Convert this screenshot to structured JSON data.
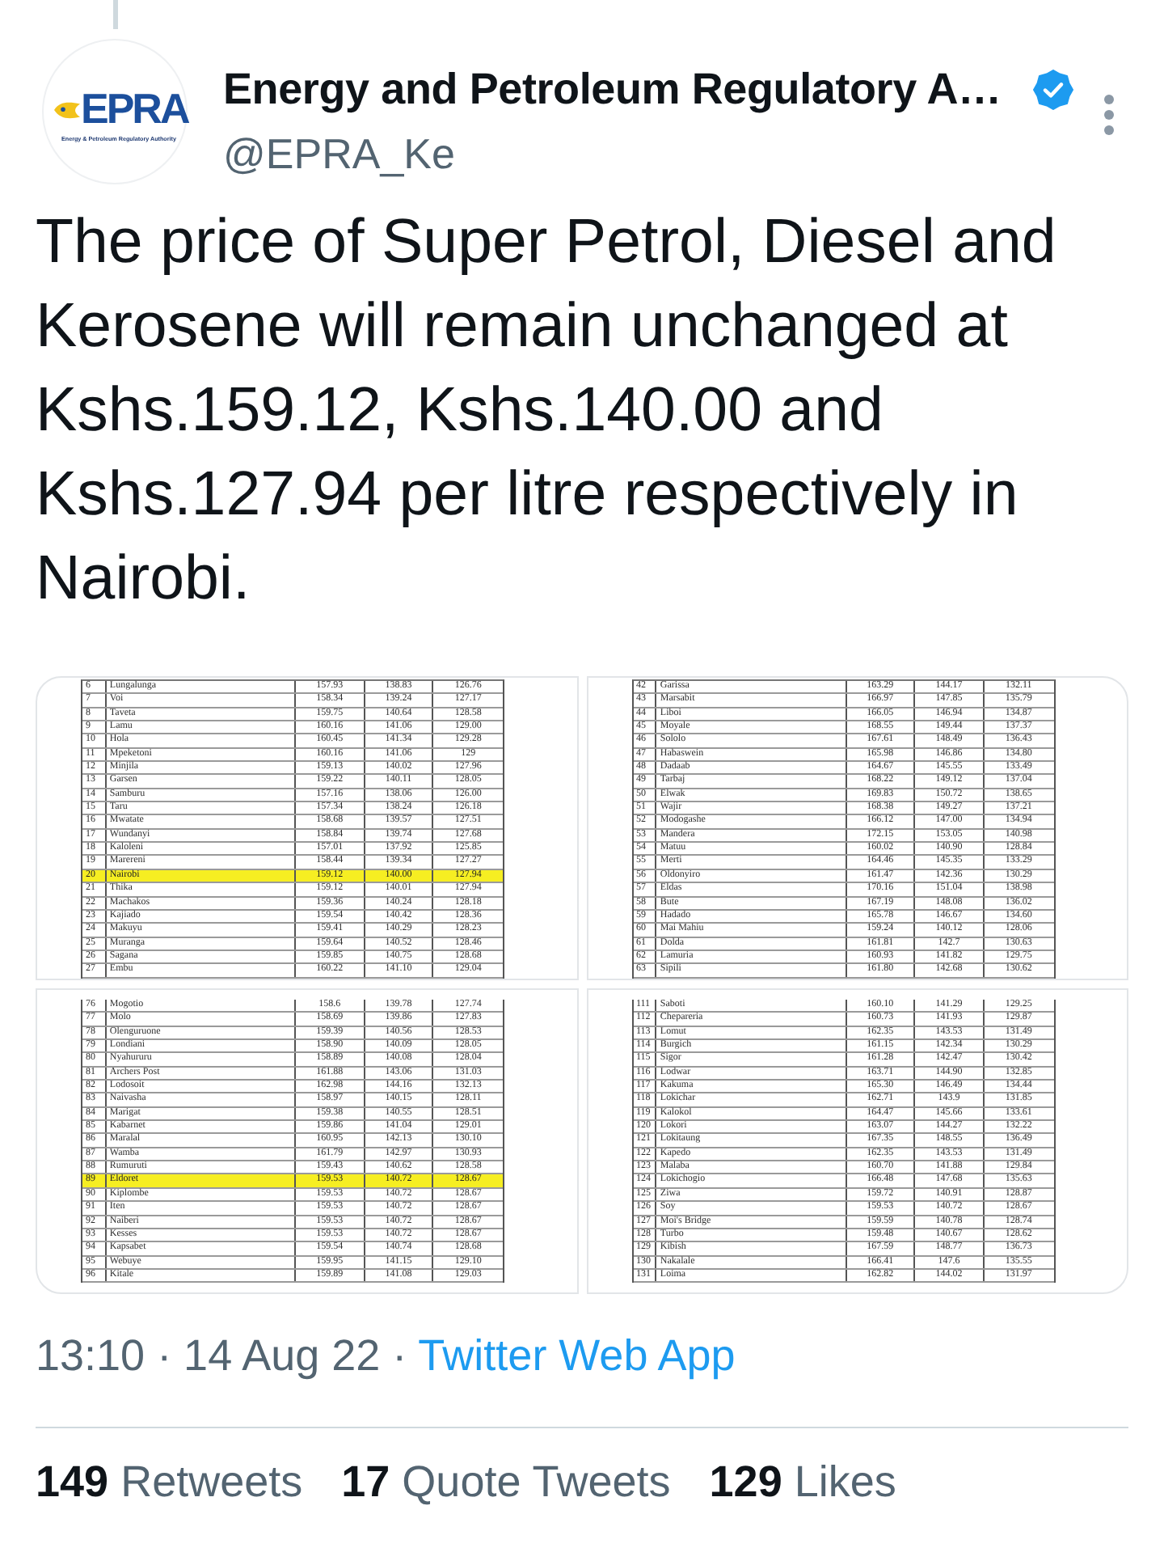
{
  "author": {
    "name": "Energy and Petroleum Regulatory A…",
    "handle": "@EPRA_Ke",
    "verified": true,
    "avatar": {
      "logo": "EPRA",
      "tagline": "Energy & Petroleum Regulatory Authority"
    }
  },
  "text": "The price of Super Petrol, Diesel and Kerosene will remain unchanged at Kshs.159.12, Kshs.140.00 and Kshs.127.94 per litre respectively in Nairobi.",
  "media": [
    {
      "rows": [
        {
          "cells": [
            "6",
            "Lungalunga",
            "157.93",
            "138.83",
            "126.76"
          ],
          "highlighted": false
        },
        {
          "cells": [
            "7",
            "Voi",
            "158.34",
            "139.24",
            "127.17"
          ],
          "highlighted": false
        },
        {
          "cells": [
            "8",
            "Taveta",
            "159.75",
            "140.64",
            "128.58"
          ],
          "highlighted": false
        },
        {
          "cells": [
            "9",
            "Lamu",
            "160.16",
            "141.06",
            "129.00"
          ],
          "highlighted": false
        },
        {
          "cells": [
            "10",
            "Hola",
            "160.45",
            "141.34",
            "129.28"
          ],
          "highlighted": false
        },
        {
          "cells": [
            "11",
            "Mpeketoni",
            "160.16",
            "141.06",
            "129"
          ],
          "highlighted": false
        },
        {
          "cells": [
            "12",
            "Minjila",
            "159.13",
            "140.02",
            "127.96"
          ],
          "highlighted": false
        },
        {
          "cells": [
            "13",
            "Garsen",
            "159.22",
            "140.11",
            "128.05"
          ],
          "highlighted": false
        },
        {
          "cells": [
            "14",
            "Samburu",
            "157.16",
            "138.06",
            "126.00"
          ],
          "highlighted": false
        },
        {
          "cells": [
            "15",
            "Taru",
            "157.34",
            "138.24",
            "126.18"
          ],
          "highlighted": false
        },
        {
          "cells": [
            "16",
            "Mwatate",
            "158.68",
            "139.57",
            "127.51"
          ],
          "highlighted": false
        },
        {
          "cells": [
            "17",
            "Wundanyi",
            "158.84",
            "139.74",
            "127.68"
          ],
          "highlighted": false
        },
        {
          "cells": [
            "18",
            "Kaloleni",
            "157.01",
            "137.92",
            "125.85"
          ],
          "highlighted": false
        },
        {
          "cells": [
            "19",
            "Marereni",
            "158.44",
            "139.34",
            "127.27"
          ],
          "highlighted": false
        },
        {
          "cells": [
            "20",
            "Nairobi",
            "159.12",
            "140.00",
            "127.94"
          ],
          "highlighted": true
        },
        {
          "cells": [
            "21",
            "Thika",
            "159.12",
            "140.01",
            "127.94"
          ],
          "highlighted": false
        },
        {
          "cells": [
            "22",
            "Machakos",
            "159.36",
            "140.24",
            "128.18"
          ],
          "highlighted": false
        },
        {
          "cells": [
            "23",
            "Kajiado",
            "159.54",
            "140.42",
            "128.36"
          ],
          "highlighted": false
        },
        {
          "cells": [
            "24",
            "Makuyu",
            "159.41",
            "140.29",
            "128.23"
          ],
          "highlighted": false
        },
        {
          "cells": [
            "25",
            "Muranga",
            "159.64",
            "140.52",
            "128.46"
          ],
          "highlighted": false
        },
        {
          "cells": [
            "26",
            "Sagana",
            "159.85",
            "140.75",
            "128.68"
          ],
          "highlighted": false
        },
        {
          "cells": [
            "27",
            "Embu",
            "160.22",
            "141.10",
            "129.04"
          ],
          "highlighted": false
        }
      ]
    },
    {
      "rows": [
        {
          "cells": [
            "42",
            "Garissa",
            "163.29",
            "144.17",
            "132.11"
          ],
          "highlighted": false
        },
        {
          "cells": [
            "43",
            "Marsabit",
            "166.97",
            "147.85",
            "135.79"
          ],
          "highlighted": false
        },
        {
          "cells": [
            "44",
            "Liboi",
            "166.05",
            "146.94",
            "134.87"
          ],
          "highlighted": false
        },
        {
          "cells": [
            "45",
            "Moyale",
            "168.55",
            "149.44",
            "137.37"
          ],
          "highlighted": false
        },
        {
          "cells": [
            "46",
            "Sololo",
            "167.61",
            "148.49",
            "136.43"
          ],
          "highlighted": false
        },
        {
          "cells": [
            "47",
            "Habaswein",
            "165.98",
            "146.86",
            "134.80"
          ],
          "highlighted": false
        },
        {
          "cells": [
            "48",
            "Dadaab",
            "164.67",
            "145.55",
            "133.49"
          ],
          "highlighted": false
        },
        {
          "cells": [
            "49",
            "Tarbaj",
            "168.22",
            "149.12",
            "137.04"
          ],
          "highlighted": false
        },
        {
          "cells": [
            "50",
            "Elwak",
            "169.83",
            "150.72",
            "138.65"
          ],
          "highlighted": false
        },
        {
          "cells": [
            "51",
            "Wajir",
            "168.38",
            "149.27",
            "137.21"
          ],
          "highlighted": false
        },
        {
          "cells": [
            "52",
            "Modogashe",
            "166.12",
            "147.00",
            "134.94"
          ],
          "highlighted": false
        },
        {
          "cells": [
            "53",
            "Mandera",
            "172.15",
            "153.05",
            "140.98"
          ],
          "highlighted": false
        },
        {
          "cells": [
            "54",
            "Matuu",
            "160.02",
            "140.90",
            "128.84"
          ],
          "highlighted": false
        },
        {
          "cells": [
            "55",
            "Merti",
            "164.46",
            "145.35",
            "133.29"
          ],
          "highlighted": false
        },
        {
          "cells": [
            "56",
            "Oldonyiro",
            "161.47",
            "142.36",
            "130.29"
          ],
          "highlighted": false
        },
        {
          "cells": [
            "57",
            "Eldas",
            "170.16",
            "151.04",
            "138.98"
          ],
          "highlighted": false
        },
        {
          "cells": [
            "58",
            "Bute",
            "167.19",
            "148.08",
            "136.02"
          ],
          "highlighted": false
        },
        {
          "cells": [
            "59",
            "Hadado",
            "165.78",
            "146.67",
            "134.60"
          ],
          "highlighted": false
        },
        {
          "cells": [
            "60",
            "Mai Mahiu",
            "159.24",
            "140.12",
            "128.06"
          ],
          "highlighted": false
        },
        {
          "cells": [
            "61",
            "Dolda",
            "161.81",
            "142.7",
            "130.63"
          ],
          "highlighted": false
        },
        {
          "cells": [
            "62",
            "Lamuria",
            "160.93",
            "141.82",
            "129.75"
          ],
          "highlighted": false
        },
        {
          "cells": [
            "63",
            "Sipili",
            "161.80",
            "142.68",
            "130.62"
          ],
          "highlighted": false
        }
      ]
    },
    {
      "rows": [
        {
          "cells": [
            "76",
            "Mogotio",
            "158.6",
            "139.78",
            "127.74"
          ],
          "highlighted": false
        },
        {
          "cells": [
            "77",
            "Molo",
            "158.69",
            "139.86",
            "127.83"
          ],
          "highlighted": false
        },
        {
          "cells": [
            "78",
            "Olenguruone",
            "159.39",
            "140.56",
            "128.53"
          ],
          "highlighted": false
        },
        {
          "cells": [
            "79",
            "Londiani",
            "158.90",
            "140.09",
            "128.05"
          ],
          "highlighted": false
        },
        {
          "cells": [
            "80",
            "Nyahururu",
            "158.89",
            "140.08",
            "128.04"
          ],
          "highlighted": false
        },
        {
          "cells": [
            "81",
            "Archers Post",
            "161.88",
            "143.06",
            "131.03"
          ],
          "highlighted": false
        },
        {
          "cells": [
            "82",
            "Lodosoit",
            "162.98",
            "144.16",
            "132.13"
          ],
          "highlighted": false
        },
        {
          "cells": [
            "83",
            "Naivasha",
            "158.97",
            "140.15",
            "128.11"
          ],
          "highlighted": false
        },
        {
          "cells": [
            "84",
            "Marigat",
            "159.38",
            "140.55",
            "128.51"
          ],
          "highlighted": false
        },
        {
          "cells": [
            "85",
            "Kabarnet",
            "159.86",
            "141.04",
            "129.01"
          ],
          "highlighted": false
        },
        {
          "cells": [
            "86",
            "Maralal",
            "160.95",
            "142.13",
            "130.10"
          ],
          "highlighted": false
        },
        {
          "cells": [
            "87",
            "Wamba",
            "161.79",
            "142.97",
            "130.93"
          ],
          "highlighted": false
        },
        {
          "cells": [
            "88",
            "Rumuruti",
            "159.43",
            "140.62",
            "128.58"
          ],
          "highlighted": false
        },
        {
          "cells": [
            "89",
            "Eldoret",
            "159.53",
            "140.72",
            "128.67"
          ],
          "highlighted": true
        },
        {
          "cells": [
            "90",
            "Kiplombe",
            "159.53",
            "140.72",
            "128.67"
          ],
          "highlighted": false
        },
        {
          "cells": [
            "91",
            "Iten",
            "159.53",
            "140.72",
            "128.67"
          ],
          "highlighted": false
        },
        {
          "cells": [
            "92",
            "Naiberi",
            "159.53",
            "140.72",
            "128.67"
          ],
          "highlighted": false
        },
        {
          "cells": [
            "93",
            "Kesses",
            "159.53",
            "140.72",
            "128.67"
          ],
          "highlighted": false
        },
        {
          "cells": [
            "94",
            "Kapsabet",
            "159.54",
            "140.74",
            "128.68"
          ],
          "highlighted": false
        },
        {
          "cells": [
            "95",
            "Webuye",
            "159.95",
            "141.15",
            "129.10"
          ],
          "highlighted": false
        },
        {
          "cells": [
            "96",
            "Kitale",
            "159.89",
            "141.08",
            "129.03"
          ],
          "highlighted": false
        }
      ]
    },
    {
      "rows": [
        {
          "cells": [
            "111",
            "Saboti",
            "160.10",
            "141.29",
            "129.25"
          ],
          "highlighted": false
        },
        {
          "cells": [
            "112",
            "Chepareria",
            "160.73",
            "141.93",
            "129.87"
          ],
          "highlighted": false
        },
        {
          "cells": [
            "113",
            "Lomut",
            "162.35",
            "143.53",
            "131.49"
          ],
          "highlighted": false
        },
        {
          "cells": [
            "114",
            "Burgich",
            "161.15",
            "142.34",
            "130.29"
          ],
          "highlighted": false
        },
        {
          "cells": [
            "115",
            "Sigor",
            "161.28",
            "142.47",
            "130.42"
          ],
          "highlighted": false
        },
        {
          "cells": [
            "116",
            "Lodwar",
            "163.71",
            "144.90",
            "132.85"
          ],
          "highlighted": false
        },
        {
          "cells": [
            "117",
            "Kakuma",
            "165.30",
            "146.49",
            "134.44"
          ],
          "highlighted": false
        },
        {
          "cells": [
            "118",
            "Lokichar",
            "162.71",
            "143.9",
            "131.85"
          ],
          "highlighted": false
        },
        {
          "cells": [
            "119",
            "Kalokol",
            "164.47",
            "145.66",
            "133.61"
          ],
          "highlighted": false
        },
        {
          "cells": [
            "120",
            "Lokori",
            "163.07",
            "144.27",
            "132.22"
          ],
          "highlighted": false
        },
        {
          "cells": [
            "121",
            "Lokitaung",
            "167.35",
            "148.55",
            "136.49"
          ],
          "highlighted": false
        },
        {
          "cells": [
            "122",
            "Kapedo",
            "162.35",
            "143.53",
            "131.49"
          ],
          "highlighted": false
        },
        {
          "cells": [
            "123",
            "Malaba",
            "160.70",
            "141.88",
            "129.84"
          ],
          "highlighted": false
        },
        {
          "cells": [
            "124",
            "Lokichogio",
            "166.48",
            "147.68",
            "135.63"
          ],
          "highlighted": false
        },
        {
          "cells": [
            "125",
            "Ziwa",
            "159.72",
            "140.91",
            "128.87"
          ],
          "highlighted": false
        },
        {
          "cells": [
            "126",
            "Soy",
            "159.53",
            "140.72",
            "128.67"
          ],
          "highlighted": false
        },
        {
          "cells": [
            "127",
            "Moi's Bridge",
            "159.59",
            "140.78",
            "128.74"
          ],
          "highlighted": false
        },
        {
          "cells": [
            "128",
            "Turbo",
            "159.48",
            "140.67",
            "128.62"
          ],
          "highlighted": false
        },
        {
          "cells": [
            "129",
            "Kibish",
            "167.59",
            "148.77",
            "136.73"
          ],
          "highlighted": false
        },
        {
          "cells": [
            "130",
            "Nakalale",
            "166.41",
            "147.6",
            "135.55"
          ],
          "highlighted": false
        },
        {
          "cells": [
            "131",
            "Loima",
            "162.82",
            "144.02",
            "131.97"
          ],
          "highlighted": false
        }
      ]
    }
  ],
  "timestamp": "13:10 · 14 Aug 22 ·",
  "source": "Twitter Web App",
  "stats": [
    {
      "count": "149",
      "label": "Retweets"
    },
    {
      "count": "17",
      "label": "Quote Tweets"
    },
    {
      "count": "129",
      "label": "Likes"
    }
  ]
}
